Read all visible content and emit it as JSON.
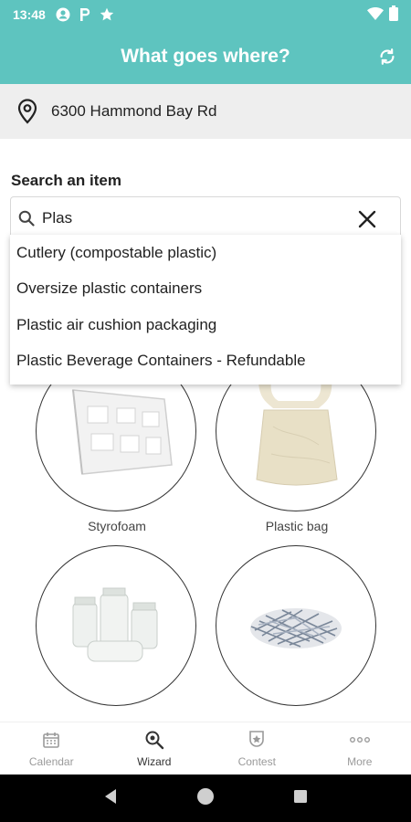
{
  "status_bar": {
    "time": "13:48",
    "icons": [
      "account-circle-icon",
      "parking-icon",
      "star-icon"
    ],
    "right_icons": [
      "wifi-icon",
      "battery-icon"
    ]
  },
  "app_bar": {
    "title": "What goes where?",
    "action_icon": "refresh-icon",
    "background": "#5ec4bf"
  },
  "location": {
    "icon": "location-pin-icon",
    "address": "6300 Hammond Bay Rd"
  },
  "search": {
    "label": "Search an item",
    "value": "Plas",
    "clear_icon": "close-icon"
  },
  "suggestions": [
    "Cutlery (compostable plastic)",
    "Oversize plastic containers",
    "Plastic air cushion packaging",
    "Plastic Beverage Containers - Refundable"
  ],
  "items": [
    {
      "caption": "Styrofoam",
      "image": "styrofoam-image"
    },
    {
      "caption": "Plastic bag",
      "image": "plastic-bag-image"
    },
    {
      "caption": "",
      "image": "glass-jars-image"
    },
    {
      "caption": "",
      "image": "shredded-paper-image"
    }
  ],
  "bottom_nav": [
    {
      "label": "Calendar",
      "icon": "calendar-icon",
      "active": false
    },
    {
      "label": "Wizard",
      "icon": "wizard-search-icon",
      "active": true
    },
    {
      "label": "Contest",
      "icon": "contest-badge-icon",
      "active": false
    },
    {
      "label": "More",
      "icon": "more-dots-icon",
      "active": false
    }
  ]
}
